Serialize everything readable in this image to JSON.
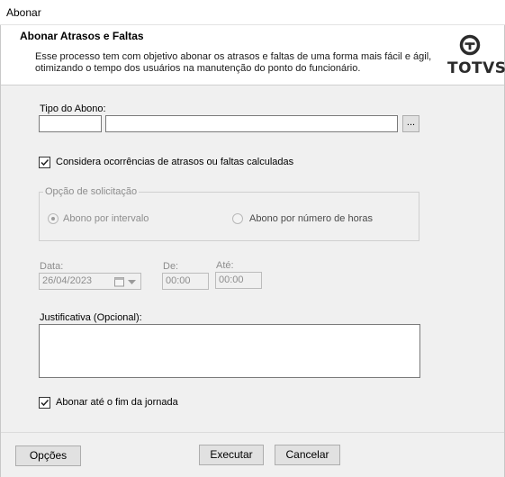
{
  "window": {
    "title": "Abonar"
  },
  "header": {
    "title": "Abonar Atrasos e Faltas",
    "description_line1": "Esse processo tem com objetivo abonar os atrasos e faltas de uma forma mais fácil e ágil,",
    "description_line2": "otimizando o tempo dos usuários na manutenção do ponto do funcionário.",
    "logo_text": "TOTVS",
    "logo_icon": "totvs-logo-icon"
  },
  "form": {
    "tipo_label": "Tipo do Abono:",
    "tipo_code": "",
    "tipo_description": "",
    "lookup_label": "...",
    "considera_label": "Considera ocorrências de atrasos ou faltas calculadas",
    "considera_checked": true,
    "opcao_group_label": "Opção de solicitação",
    "radio_intervalo": "Abono por intervalo",
    "radio_horas": "Abono por número de horas",
    "selected_option": "Abono por intervalo",
    "data_label": "Data:",
    "data_value": "26/04/2023",
    "de_label": "De:",
    "de_value": "00:00",
    "ate_label": "Até:",
    "ate_value": "00:00",
    "justificativa_label": "Justificativa (Opcional):",
    "justificativa_value": "",
    "fim_jornada_label": "Abonar até o fim da jornada",
    "fim_jornada_checked": true
  },
  "footer": {
    "options_label": "Opções",
    "execute_label": "Executar",
    "cancel_label": "Cancelar"
  }
}
